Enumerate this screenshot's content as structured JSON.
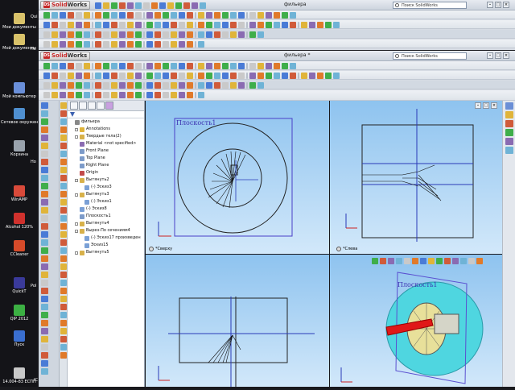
{
  "desktop": {
    "icons": [
      {
        "label": "Мои документы",
        "color": "#d9c26a"
      },
      {
        "label": "Мой документы",
        "color": "#d9c26a"
      },
      {
        "label": "Мой компьютер",
        "color": "#6a8fd9"
      },
      {
        "label": "Сетевое окружение",
        "color": "#4f8fd0"
      },
      {
        "label": "Корзина",
        "color": "#9aa3ad"
      },
      {
        "label": "WinAMP",
        "color": "#d94a3a"
      },
      {
        "label": "Alcohol 120%",
        "color": "#d0312d"
      },
      {
        "label": "CCleaner",
        "color": "#d64b2a"
      },
      {
        "label": "QuickT",
        "color": "#3a3a9a"
      },
      {
        "label": "QIP 2012",
        "color": "#3cb043"
      },
      {
        "label": "Пуск",
        "color": "#3a6fd0"
      },
      {
        "label": "14.004-83 ЕСПП",
        "color": "#c9c9c9"
      }
    ],
    "side_labels": [
      "Qui",
      "Нo",
      "Ho",
      "Pol",
      "IC"
    ]
  },
  "back_window": {
    "app_name_sw": "Solid",
    "app_name_wk": "Works",
    "title": "фильера",
    "search_placeholder": "Поиск SolidWorks"
  },
  "front_window": {
    "app_name_sw": "Solid",
    "app_name_wk": "Works",
    "title": "фильера *",
    "search_placeholder": "Поиск SolidWorks"
  },
  "tree": {
    "items": [
      {
        "label": "фильера",
        "indent": 0,
        "icon": "part-icon",
        "color": "#888888",
        "plus": false
      },
      {
        "label": "Annotations",
        "indent": 1,
        "icon": "annotations-icon",
        "color": "#e0b43a",
        "plus": true
      },
      {
        "label": "Твердые тела(2)",
        "indent": 1,
        "icon": "solid-bodies-icon",
        "color": "#d8b14a",
        "plus": true
      },
      {
        "label": "Material <not specified>",
        "indent": 1,
        "icon": "material-icon",
        "color": "#8a6bb2",
        "plus": false
      },
      {
        "label": "Front Plane",
        "indent": 1,
        "icon": "plane-icon",
        "color": "#7d9bc9",
        "plus": false
      },
      {
        "label": "Top Plane",
        "indent": 1,
        "icon": "plane-icon",
        "color": "#7d9bc9",
        "plus": false
      },
      {
        "label": "Right Plane",
        "indent": 1,
        "icon": "plane-icon",
        "color": "#7d9bc9",
        "plus": false
      },
      {
        "label": "Origin",
        "indent": 1,
        "icon": "origin-icon",
        "color": "#c24a4a",
        "plus": false
      },
      {
        "label": "Вытянуть2",
        "indent": 1,
        "icon": "extrude-icon",
        "color": "#d8b14a",
        "plus": true
      },
      {
        "label": "(-) Эскиз3",
        "indent": 2,
        "icon": "sketch-icon",
        "color": "#7aa0d6",
        "plus": false
      },
      {
        "label": "Вытянуть3",
        "indent": 1,
        "icon": "extrude-icon",
        "color": "#d8b14a",
        "plus": true
      },
      {
        "label": "(-) Эскиз1",
        "indent": 2,
        "icon": "sketch-icon",
        "color": "#7aa0d6",
        "plus": false
      },
      {
        "label": "(-) Эскиз8",
        "indent": 1,
        "icon": "sketch-icon",
        "color": "#7aa0d6",
        "plus": false
      },
      {
        "label": "Плоскость1",
        "indent": 1,
        "icon": "plane-icon",
        "color": "#7d9bc9",
        "plus": false
      },
      {
        "label": "Вытянуть4",
        "indent": 1,
        "icon": "extrude-icon",
        "color": "#d8b14a",
        "plus": true
      },
      {
        "label": "Вырез-По сечениям4",
        "indent": 1,
        "icon": "loft-cut-icon",
        "color": "#d8b14a",
        "plus": true
      },
      {
        "label": "(-) Эскиз17 произведен",
        "indent": 2,
        "icon": "sketch-icon",
        "color": "#7aa0d6",
        "plus": false
      },
      {
        "label": "Эскиз15",
        "indent": 2,
        "icon": "sketch-icon",
        "color": "#7aa0d6",
        "plus": false
      },
      {
        "label": "Вытянуть5",
        "indent": 1,
        "icon": "extrude-icon",
        "color": "#d8b14a",
        "plus": true
      }
    ]
  },
  "viewports": {
    "top_left": {
      "label": "*Сверху",
      "plane_label": "Плоскость1"
    },
    "top_right": {
      "label": "*Слева"
    },
    "bottom_right": {
      "plane_label": "Плоскость1"
    }
  },
  "colors": {
    "viewport_top": "#8ec3ef",
    "viewport_bottom": "#d2e8fa",
    "plane": "#5a4fd0",
    "red_body": "#e02020"
  }
}
